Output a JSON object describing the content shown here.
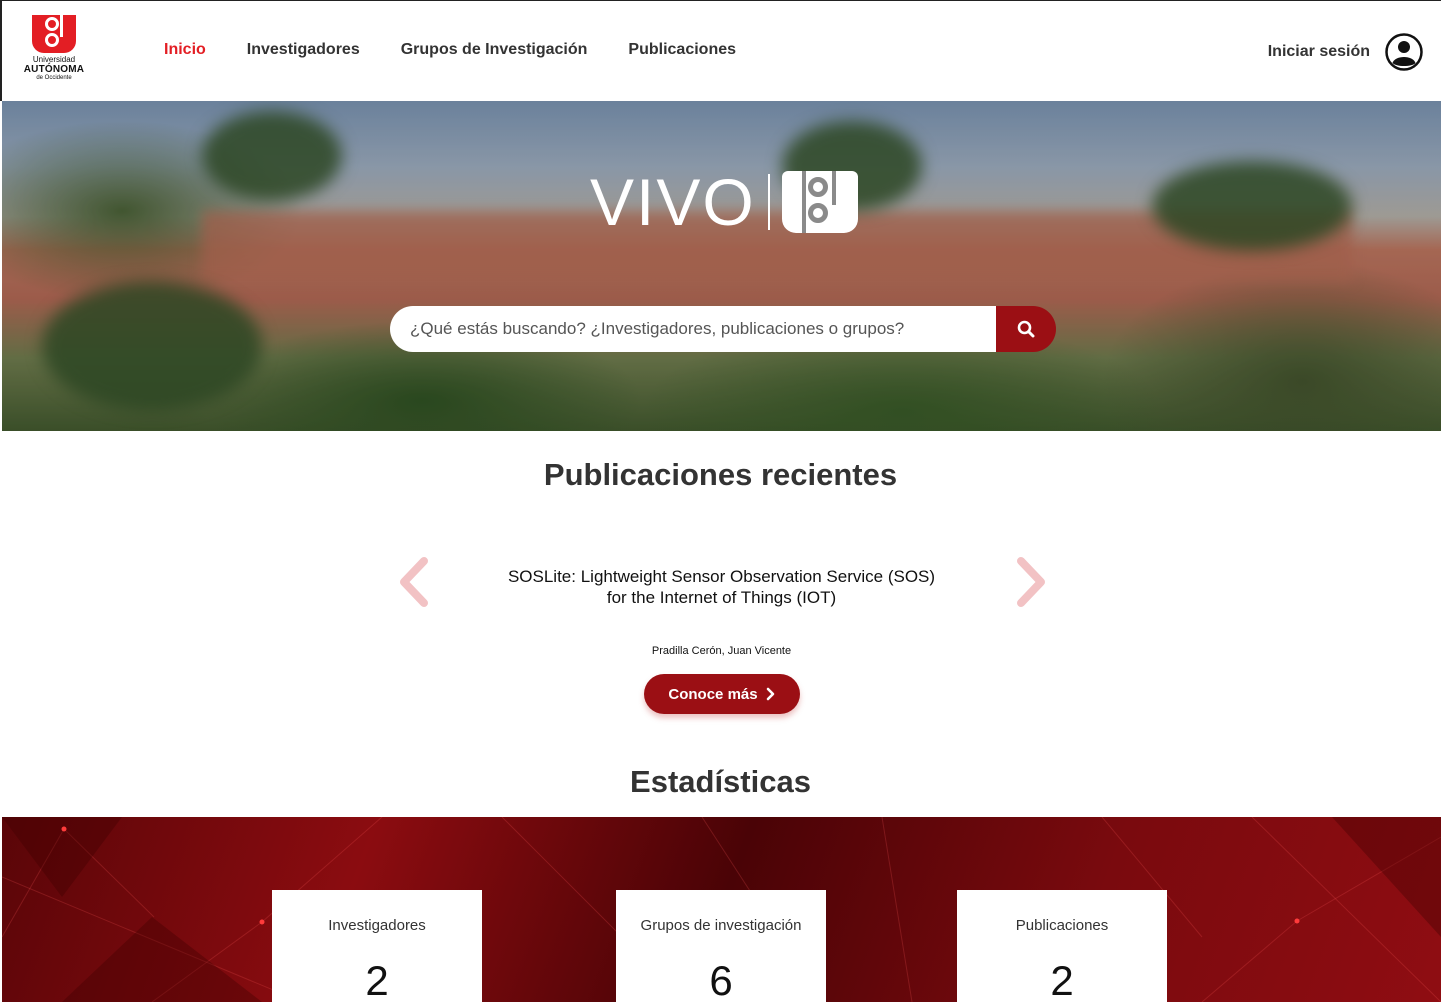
{
  "logo": {
    "line1": "Universidad",
    "line2": "AUTÓNOMA",
    "line3": "de Occidente"
  },
  "nav": {
    "items": [
      {
        "label": "Inicio",
        "active": true
      },
      {
        "label": "Investigadores",
        "active": false
      },
      {
        "label": "Grupos de Investigación",
        "active": false
      },
      {
        "label": "Publicaciones",
        "active": false
      }
    ]
  },
  "header": {
    "login_label": "Iniciar sesión"
  },
  "hero": {
    "brand": "VIVO",
    "search_placeholder": "¿Qué estás buscando? ¿Investigadores, publicaciones o grupos?"
  },
  "recent": {
    "title": "Publicaciones recientes",
    "publication_title": "SOSLite: Lightweight Sensor Observation Service (SOS) for the Internet of Things (IOT)",
    "author": "Pradilla Cerón, Juan Vicente",
    "more_label": "Conoce más"
  },
  "stats": {
    "title": "Estadísticas",
    "cards": [
      {
        "label": "Investigadores",
        "value": "2"
      },
      {
        "label": "Grupos de investigación",
        "value": "6"
      },
      {
        "label": "Publicaciones",
        "value": "2"
      }
    ]
  },
  "colors": {
    "accent": "#e31e24",
    "primary_dark": "#9b0f14",
    "text": "#333333"
  }
}
